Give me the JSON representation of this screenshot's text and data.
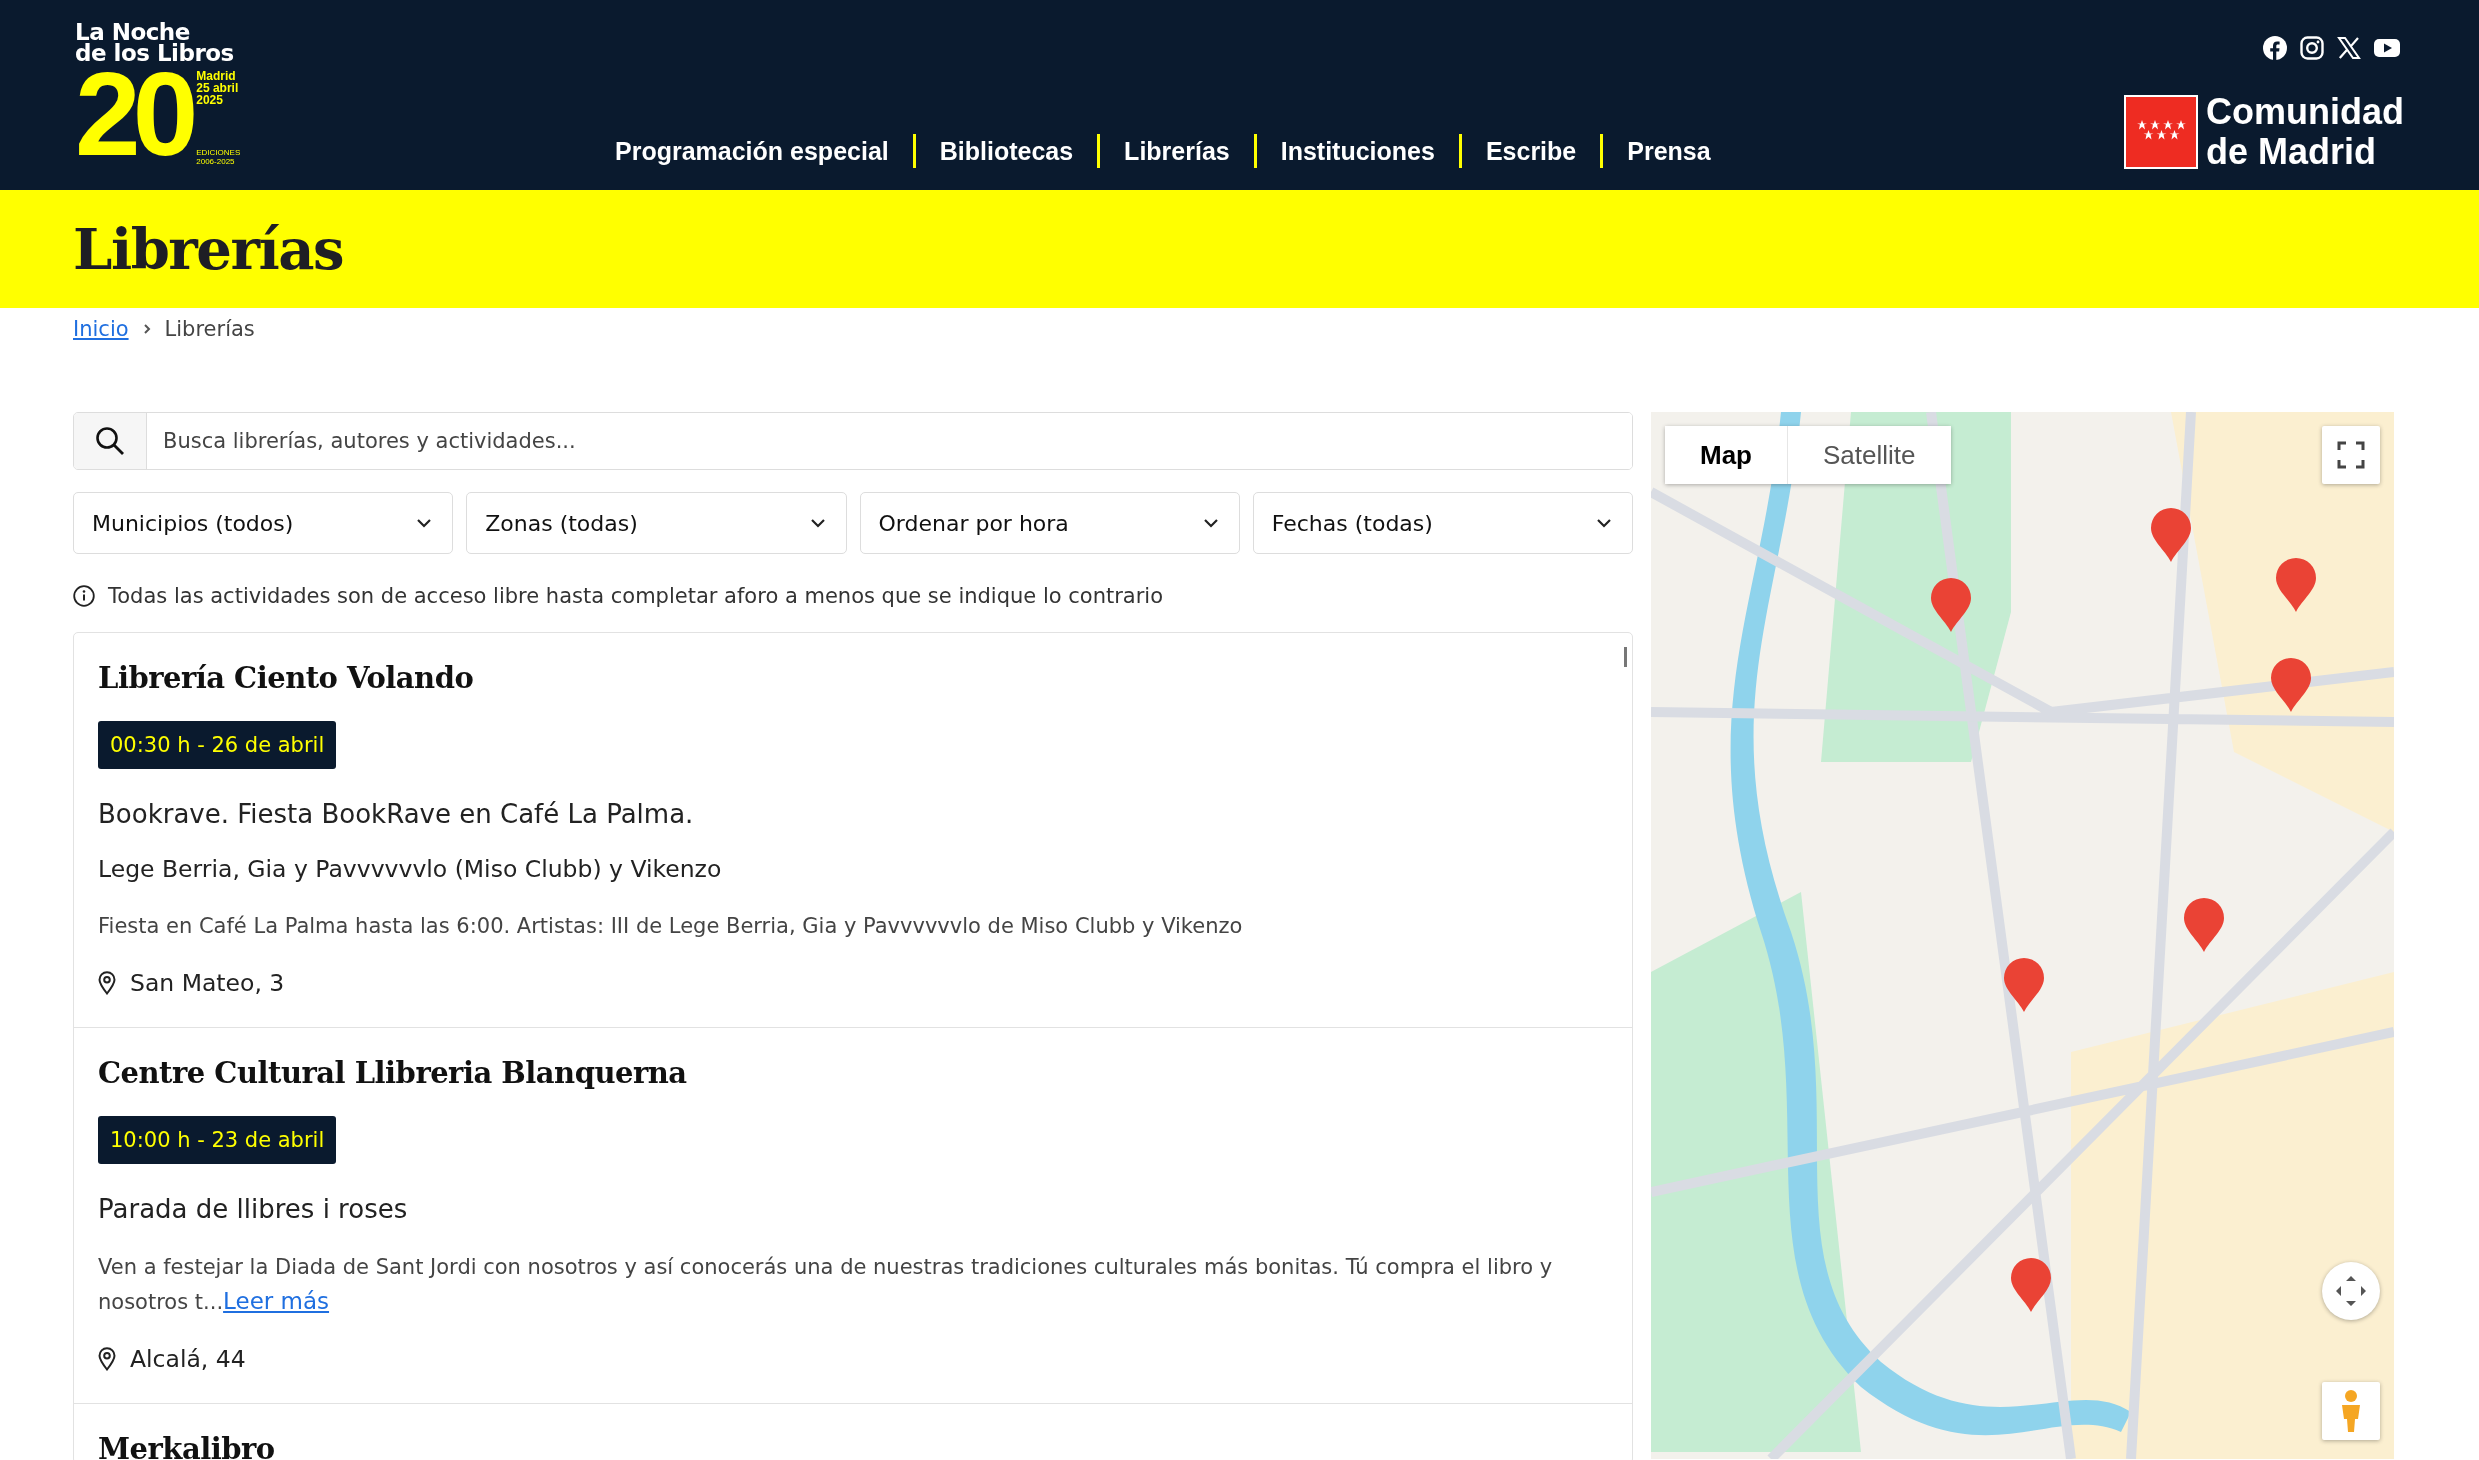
{
  "header": {
    "logo": {
      "line_1": "La Noche",
      "line_2": "de los Libros",
      "number": "20",
      "place": "Madrid",
      "date": "25 abril",
      "year": "2025",
      "editions": "EDICIONES",
      "editions_range": "2006-2025"
    },
    "nav": [
      {
        "label": "Programación especial"
      },
      {
        "label": "Bibliotecas"
      },
      {
        "label": "Librerías"
      },
      {
        "label": "Instituciones"
      },
      {
        "label": "Escribe"
      },
      {
        "label": "Prensa"
      }
    ],
    "social": [
      {
        "kind": "facebook"
      },
      {
        "kind": "instagram"
      },
      {
        "kind": "x"
      },
      {
        "kind": "youtube"
      }
    ],
    "sponsor": {
      "line_1": "Comunidad",
      "line_2": "de Madrid"
    }
  },
  "page_title": "Librerías",
  "breadcrumb": [
    {
      "label": "Inicio",
      "link": true
    },
    {
      "label": "Librerías",
      "link": false
    }
  ],
  "search": {
    "placeholder": "Busca librerías, autores y actividades..."
  },
  "filters": [
    {
      "label": "Municipios (todos)"
    },
    {
      "label": "Zonas (todas)"
    },
    {
      "label": "Ordenar por hora"
    },
    {
      "label": "Fechas (todas)"
    }
  ],
  "notice": "Todas las actividades son de acceso libre hasta completar aforo a menos que se indique lo contrario",
  "results": [
    {
      "name": "Librería Ciento Volando",
      "when": "00:30 h - 26 de abril",
      "title": "Bookrave. Fiesta BookRave en Café La Palma.",
      "performers": "Lege Berria, Gia y Pavvvvvvlo (Miso Clubb) y Vikenzo",
      "description": "Fiesta en Café La Palma hasta las 6:00. Artistas: III de Lege Berria, Gia y Pavvvvvvlo de Miso Clubb y Vikenzo",
      "address": "San Mateo, 3"
    },
    {
      "name": "Centre Cultural Llibreria Blanquerna",
      "when": "10:00 h - 23 de abril",
      "title": "Parada de llibres i roses",
      "description": "Ven a festejar la Diada de Sant Jordi con nosotros y así conocerás una de nuestras tradiciones culturales más bonitas. Tú compra el libro y nosotros t...",
      "more_link": "Leer más",
      "address": "Alcalá, 44"
    },
    {
      "name": "Merkalibro"
    }
  ],
  "map": {
    "kind": "picture",
    "types": [
      {
        "label": "Map",
        "selected": true
      },
      {
        "label": "Satellite",
        "selected": false
      }
    ]
  }
}
